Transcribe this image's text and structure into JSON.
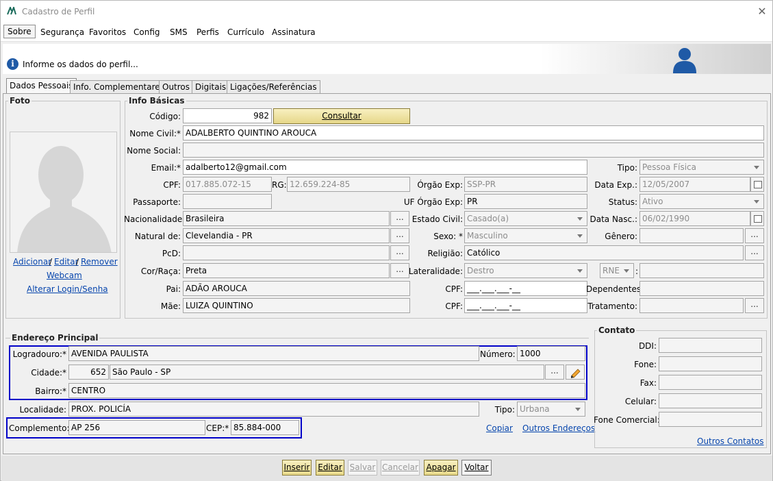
{
  "window": {
    "title": "Cadastro de Perfil"
  },
  "menu": [
    "Sobre",
    "Segurança",
    "Favoritos",
    "Config",
    "SMS",
    "Perfis",
    "Currículo",
    "Assinatura"
  ],
  "info": {
    "text": "Informe os dados do perfil..."
  },
  "tabs": [
    "Dados Pessoais",
    "Info. Complementares",
    "Outros",
    "Digitais",
    "Ligações/Referências"
  ],
  "foto": {
    "title": "Foto",
    "add": "Adicionar",
    "sep": "/",
    "edit": "Editar",
    "remove": "Remover",
    "webcam": "Webcam",
    "alter_login": "Alterar Login/Senha"
  },
  "info_basicas": {
    "title": "Info Básicas",
    "codigo_label": "Código:",
    "codigo": "982",
    "consultar": "Consultar",
    "nome_civil_label": "Nome Civil:*",
    "nome_civil": "ADALBERTO QUINTINO AROUCA",
    "nome_social_label": "Nome Social:",
    "nome_social": "",
    "email_label": "Email:*",
    "email": "adalberto12@gmail.com",
    "tipo_label": "Tipo:",
    "tipo": "Pessoa Física",
    "cpf_label": "CPF:",
    "cpf": "017.885.072-15",
    "rg_label": "RG:",
    "rg": "12.659.224-85",
    "orgao_exp_label": "Órgão Exp:",
    "orgao_exp": "SSP-PR",
    "data_exp_label": "Data Exp.:",
    "data_exp": "12/05/2007",
    "passaporte_label": "Passaporte:",
    "passaporte": "",
    "uf_orgao_label": "UF Órgão Exp:",
    "uf_orgao": "PR",
    "status_label": "Status:",
    "status": "Ativo",
    "nacionalidade_label": "Nacionalidade:",
    "nacionalidade": "Brasileira",
    "estado_civil_label": "Estado Civil:",
    "estado_civil": "Casado(a)",
    "data_nasc_label": "Data Nasc.:",
    "data_nasc": "06/02/1990",
    "natural_label": "Natural de:",
    "natural": "Clevelandia - PR",
    "sexo_label": "Sexo: *",
    "sexo": "Masculino",
    "genero_label": "Gênero:",
    "genero": "",
    "pcd_label": "PcD:",
    "pcd": "",
    "religiao_label": "Religião:",
    "religiao": "Católico",
    "cor_label": "Cor/Raça:",
    "cor": "Preta",
    "lateralidade_label": "Lateralidade:",
    "lateralidade": "Destro",
    "rne": "RNE",
    "rne_colon": ":",
    "rne_value": "",
    "pai_label": "Pai:",
    "pai": "ADÃO AROUCA",
    "cpf_pai_label": "CPF:",
    "cpf_pai": "___.___.___-__",
    "dependentes_label": "Dependentes:",
    "dependentes": "",
    "mae_label": "Mãe:",
    "mae": "LUIZA QUINTINO",
    "cpf_mae_label": "CPF:",
    "cpf_mae": "___.___.___-__",
    "tratamento_label": "Tratamento:",
    "tratamento": "",
    "dots": "..."
  },
  "endereco": {
    "title": "Endereço Principal",
    "logradouro_label": "Logradouro:*",
    "logradouro": "AVENIDA PAULISTA",
    "numero_label": "Número:",
    "numero": "1000",
    "cidade_label": "Cidade:*",
    "cidade_cod": "652",
    "cidade": "São Paulo - SP",
    "bairro_label": "Bairro:*",
    "bairro": "CENTRO",
    "localidade_label": "Localidade:",
    "localidade": "PROX. POLICÍA",
    "tipo_label": "Tipo:",
    "tipo": "Urbana",
    "complemento_label": "Complemento:",
    "complemento": "AP 256",
    "cep_label": "CEP:*",
    "cep": "85.884-000",
    "copiar": "Copiar",
    "outros_enderecos": "Outros Endereços"
  },
  "contato": {
    "title": "Contato",
    "ddi_label": "DDI:",
    "fone_label": "Fone:",
    "fax_label": "Fax:",
    "celular_label": "Celular:",
    "fone_comercial_label": "Fone Comercial:",
    "outros_contatos": "Outros Contatos"
  },
  "buttons": {
    "inserir": "Inserir",
    "editar": "Editar",
    "salvar": "Salvar",
    "cancelar": "Cancelar",
    "apagar": "Apagar",
    "voltar": "Voltar"
  },
  "colors": {
    "accent_border": "#0000c8",
    "link": "#0645ad",
    "consult_button": "#f0e4a0"
  }
}
